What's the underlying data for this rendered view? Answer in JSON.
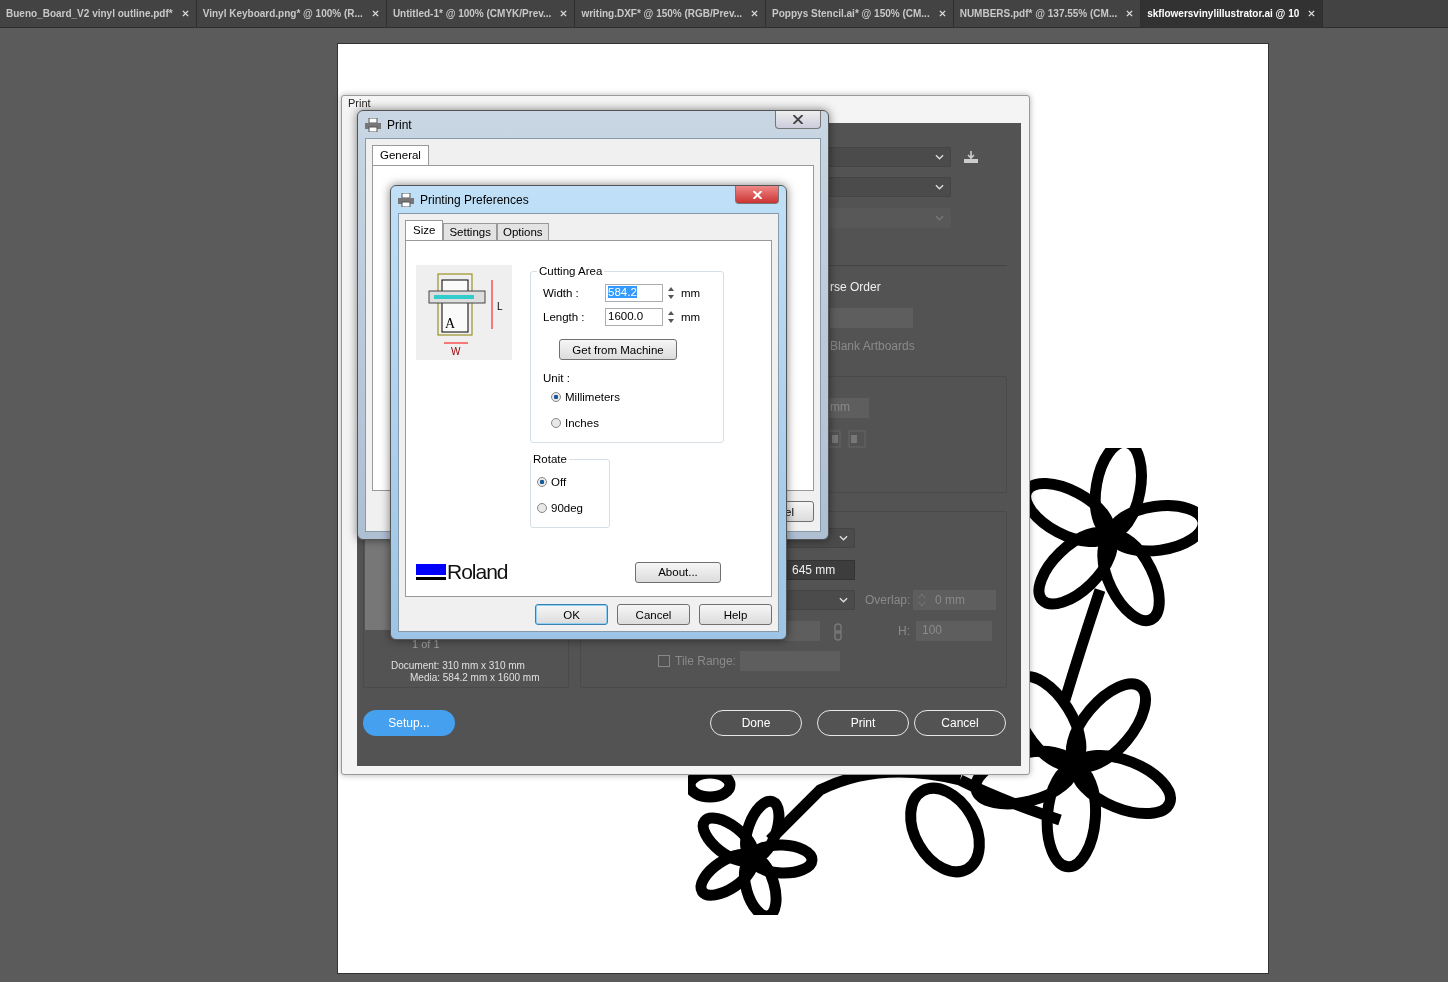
{
  "tabs": [
    {
      "label": "Bueno_Board_V2 vinyl outline.pdf*",
      "selected": false
    },
    {
      "label": "Vinyl Keyboard.png* @ 100% (R...",
      "selected": false
    },
    {
      "label": "Untitled-1* @ 100% (CMYK/Prev...",
      "selected": false
    },
    {
      "label": "writing.DXF* @ 150% (RGB/Prev...",
      "selected": false
    },
    {
      "label": "Poppys Stencil.ai* @ 150% (CM...",
      "selected": false
    },
    {
      "label": "NUMBERS.pdf* @ 137.55% (CM...",
      "selected": false
    },
    {
      "label": "skflowersvinylillustrator.ai @ 10",
      "selected": true
    }
  ],
  "ai_print_dialog": {
    "title": "Print",
    "reverse_order": "rse Order",
    "blank_artboards": "Blank Artboards",
    "offset_unit": "mm",
    "tile_size": "645 mm",
    "overlap_label": "Overlap:",
    "overlap": "0 mm",
    "h_label": "H:",
    "h_value": "100",
    "tile_range": {
      "label": "Tile Range:",
      "checked": false
    },
    "page_nav": "1 of 1",
    "document_info": "Document: 310 mm x 310 mm",
    "media_info": "Media: 584.2 mm x 1600 mm",
    "buttons": [
      {
        "label": "Setup...",
        "kind": "primary"
      },
      {
        "label": "Done",
        "kind": "outline"
      },
      {
        "label": "Print",
        "kind": "outline"
      },
      {
        "label": "Cancel",
        "kind": "outline"
      }
    ]
  },
  "print_dialog": {
    "title": "Print",
    "tabs": [
      {
        "label": "General",
        "selected": true
      }
    ],
    "partial_button": "el"
  },
  "preferences_dialog": {
    "title": "Printing Preferences",
    "tabs": [
      {
        "label": "Size",
        "selected": true
      },
      {
        "label": "Settings",
        "selected": false
      },
      {
        "label": "Options",
        "selected": false
      }
    ],
    "diagram": {
      "sheet_mark": "A",
      "length_mark": "L",
      "width_mark": "W"
    },
    "cutting_area": {
      "title": "Cutting Area",
      "fields": [
        {
          "label": "Width :",
          "value": "584.2",
          "unit": "mm",
          "text_selected": true
        },
        {
          "label": "Length :",
          "value": "1600.0",
          "unit": "mm",
          "text_selected": false
        }
      ],
      "get_button": "Get from Machine",
      "unit_label": "Unit :",
      "units": [
        {
          "label": "Millimeters",
          "selected": true
        },
        {
          "label": "Inches",
          "selected": false
        }
      ]
    },
    "rotate": {
      "title": "Rotate",
      "options": [
        {
          "label": "Off",
          "selected": true
        },
        {
          "label": "90deg",
          "selected": false
        }
      ]
    },
    "brand": "Roland",
    "about_button": "About...",
    "buttons": [
      {
        "label": "OK",
        "default": true
      },
      {
        "label": "Cancel",
        "default": false
      },
      {
        "label": "Help",
        "default": false
      }
    ]
  }
}
